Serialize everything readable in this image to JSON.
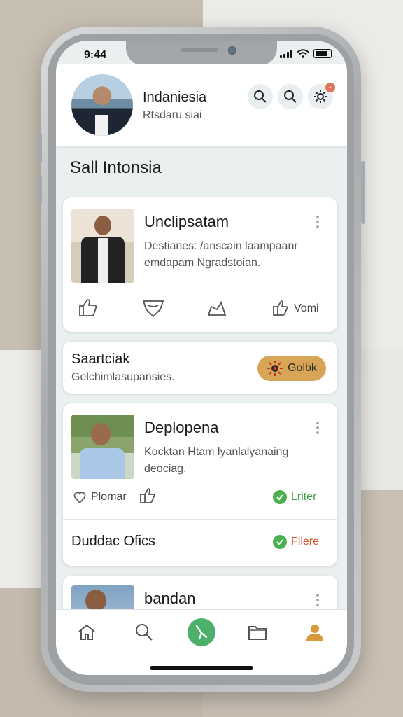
{
  "status_bar": {
    "time": "9:44"
  },
  "header": {
    "name": "Indaniesia",
    "subtitle": "Rtsdaru siai",
    "icons": [
      "search-icon",
      "search-icon",
      "settings-icon"
    ],
    "notification_badge": "•"
  },
  "section_title": "Sall Intonsia",
  "cards": {
    "post1": {
      "title": "Unclipsatam",
      "description": "Destianes: /anscain laampaanr emdapam Ngradstoian.",
      "actions": {
        "like_icon": "thumbs-up-icon",
        "comment_icon": "comment-icon",
        "share_icon": "share-icon",
        "more_label": "Vomi"
      }
    },
    "search_card": {
      "title": "Saartciak",
      "subtitle": "Gelchimlasupansies.",
      "button_label": "Golbk"
    },
    "post2": {
      "title": "Deplopena",
      "description": "Kocktan Htam lyanlalyanaing deociag.",
      "actions": {
        "follow_label": "Plomar",
        "status_label": "Lriter"
      },
      "footer": {
        "title": "Duddac Ofics",
        "status_label": "Fllere"
      }
    },
    "post3": {
      "title": "bandan"
    }
  },
  "nav": {
    "items": [
      "home-icon",
      "search-icon",
      "compose-icon",
      "folder-icon",
      "profile-icon"
    ],
    "active_index": 2
  },
  "colors": {
    "accent_green": "#4cb06a",
    "pill_gold": "#d8a455",
    "status_green": "#3ea046",
    "status_orange": "#d0552f",
    "profile_orange": "#d99a3d"
  }
}
